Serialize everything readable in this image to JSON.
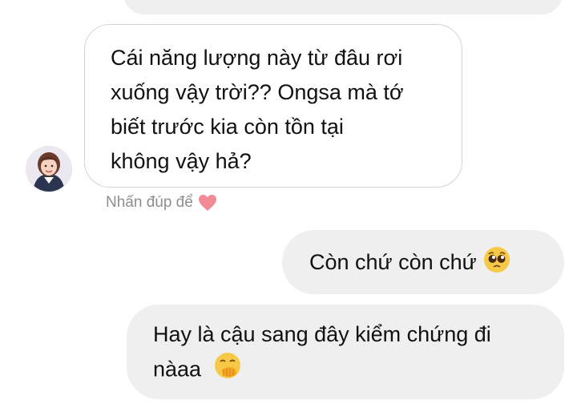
{
  "incoming": {
    "lines": [
      "Cái năng lượng này từ đâu rơi",
      "xuống vậy trời?? Ongsa mà tớ",
      "biết trước kia còn tồn tại",
      "không vậy hả?"
    ],
    "hint": "Nhấn đúp để"
  },
  "outgoing": [
    {
      "text": "Còn chứ còn chứ",
      "emoji": "pleading-face"
    },
    {
      "lines": [
        "Hay là cậu sang đây kiểm chứng đi",
        "nàaa"
      ],
      "emoji": "hand-over-mouth-face"
    }
  ],
  "colors": {
    "bubble_gray": "#efefef",
    "border_gray": "#d4d4d4",
    "hint_gray": "#8e8e8e",
    "heart_pink": "#f28b96"
  }
}
